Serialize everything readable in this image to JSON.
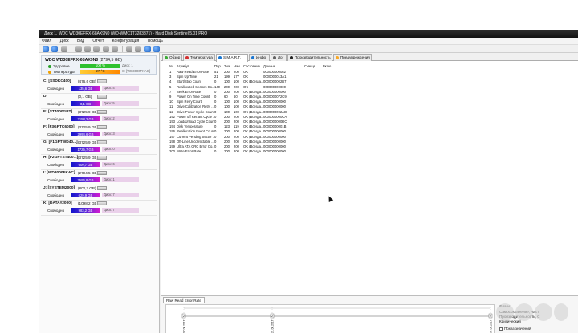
{
  "window": {
    "title": "Диск 1, WDC WD30EFRX-68AX9N0 (WD-WMC1T3283871) - Hard Disk Sentinel 5.01 PRO"
  },
  "menu": [
    "Файл",
    "Диск",
    "Вид",
    "Отчёт",
    "Конфигурация",
    "Помощь"
  ],
  "disk": {
    "name": "WDC WD30EFRX-68AX9N0",
    "size": "(2794,5 GB)",
    "health_label": "Здоровье",
    "health_value": "100 %",
    "health_side": "Диск: 1",
    "temp_label": "Температура",
    "temp_value": "27 °C",
    "temp_side": "S: [WD3000FKAC]"
  },
  "volumes": [
    {
      "name": "C: [SSDKC400]",
      "size": "(476,6 GB)",
      "free_label": "Свободно",
      "free": "135,6 GB",
      "disk": "Диск: 4"
    },
    {
      "name": "D:",
      "size": "(0,1 GB)",
      "free_label": "Свободно",
      "free": "0,1 GB",
      "disk": "Диск: 5"
    },
    {
      "name": "E: [ST4000GPT]",
      "size": "(3725,9 GB)",
      "free_label": "Свободно",
      "free": "2158,2 GB",
      "disk": "Диск: 2"
    },
    {
      "name": "F: [F3GPTC6000]",
      "size": "(3725,9 GB)",
      "free_label": "Свободно",
      "free": "2994,6 GB",
      "disk": "Диск: 3"
    },
    {
      "name": "G: [F1GPTWD40...]",
      "size": "(3725,9 GB)",
      "free_label": "Свободно",
      "free": "1725,7 GB",
      "disk": "Диск: 0"
    },
    {
      "name": "H: [F2GPTST400...]",
      "size": "(3725,9 GB)",
      "free_label": "Свободно",
      "free": "609,7 GB",
      "disk": "Диск: 6"
    },
    {
      "name": "I: [WD3000FKAC]",
      "size": "(2794,5 GB)",
      "free_label": "Свободно",
      "free": "2596,8 GB",
      "disk": "Диск: 1"
    },
    {
      "name": "J: [SYSTEM2000]",
      "size": "(802,7 GB)",
      "free_label": "Свободно",
      "free": "629,9 GB",
      "disk": "Диск: 7"
    },
    {
      "name": "K: [DATA#2000]",
      "size": "(1098,2 GB)",
      "free_label": "Свободно",
      "free": "983,2 GB",
      "disk": "Диск: 7"
    }
  ],
  "tabs": [
    {
      "label": "Обзор",
      "color": "#3aaa35"
    },
    {
      "label": "Температура",
      "color": "#d32f2f"
    },
    {
      "label": "S.M.A.R.T.",
      "color": "#1976d2"
    },
    {
      "label": "Инфо",
      "color": "#1976d2"
    },
    {
      "label": "Лог",
      "color": "#616161"
    },
    {
      "label": "Производительность",
      "color": "#212121"
    },
    {
      "label": "Предупреждения",
      "color": "#f9a825"
    }
  ],
  "smart": {
    "headers": [
      "№",
      "Атрибут",
      "Пор...",
      "Зна...",
      "Наи...",
      "Состояние",
      "Данные",
      "Смеще...",
      "Вклю..."
    ],
    "rows": [
      {
        "ok": true,
        "id": "1",
        "attr": "Raw Read Error Rate",
        "thr": "51",
        "val": "200",
        "worst": "200",
        "state": "OK",
        "data": "000000000082"
      },
      {
        "ok": true,
        "id": "3",
        "attr": "Spin Up Time",
        "thr": "21",
        "val": "199",
        "worst": "177",
        "state": "OK",
        "data": "0000000013A1"
      },
      {
        "ok": false,
        "id": "4",
        "attr": "Start/Stop Count",
        "thr": "0",
        "val": "100",
        "worst": "100",
        "state": "OK (Всегда...",
        "data": "0000000002B7"
      },
      {
        "ok": true,
        "id": "5",
        "attr": "Reallocated Sectors Co...",
        "thr": "140",
        "val": "200",
        "worst": "200",
        "state": "OK",
        "data": "000000000000"
      },
      {
        "ok": false,
        "id": "7",
        "attr": "Seek Error Rate",
        "thr": "0",
        "val": "200",
        "worst": "200",
        "state": "OK (Всегда...",
        "data": "000000000000"
      },
      {
        "ok": false,
        "id": "9",
        "attr": "Power On Time Count",
        "thr": "0",
        "val": "60",
        "worst": "60",
        "state": "OK (Всегда...",
        "data": "0000000072C9"
      },
      {
        "ok": true,
        "id": "10",
        "attr": "Spin Retry Count",
        "thr": "0",
        "val": "100",
        "worst": "100",
        "state": "OK (Всегда...",
        "data": "000000000000"
      },
      {
        "ok": false,
        "id": "11",
        "attr": "Drive Calibration Retry ...",
        "thr": "0",
        "val": "100",
        "worst": "100",
        "state": "OK (Всегда...",
        "data": "000000000000"
      },
      {
        "ok": false,
        "id": "12",
        "attr": "Drive Power Cycle Count",
        "thr": "0",
        "val": "100",
        "worst": "100",
        "state": "OK (Всегда...",
        "data": "0000000002AD"
      },
      {
        "ok": false,
        "id": "192",
        "attr": "Power off Retract Cycle ...",
        "thr": "0",
        "val": "200",
        "worst": "200",
        "state": "OK (Всегда...",
        "data": "0000000000CA"
      },
      {
        "ok": false,
        "id": "193",
        "attr": "Load/Unload Cycle Count",
        "thr": "0",
        "val": "200",
        "worst": "200",
        "state": "OK (Всегда...",
        "data": "0000000000DC"
      },
      {
        "ok": false,
        "id": "194",
        "attr": "Disk Temperature",
        "thr": "0",
        "val": "123",
        "worst": "119",
        "state": "OK (Всегда...",
        "data": "00000000001B"
      },
      {
        "ok": true,
        "id": "196",
        "attr": "Reallocation Event Count",
        "thr": "0",
        "val": "200",
        "worst": "200",
        "state": "OK (Всегда...",
        "data": "000000000000"
      },
      {
        "ok": true,
        "id": "197",
        "attr": "Current Pending Sector ...",
        "thr": "0",
        "val": "200",
        "worst": "200",
        "state": "OK (Всегда...",
        "data": "000000000000"
      },
      {
        "ok": true,
        "id": "198",
        "attr": "Off-Line Uncorrectable ...",
        "thr": "0",
        "val": "200",
        "worst": "200",
        "state": "OK (Всегда...",
        "data": "000000000000"
      },
      {
        "ok": false,
        "id": "199",
        "attr": "Ultra ATA CRC Error Co...",
        "thr": "0",
        "val": "200",
        "worst": "200",
        "state": "OK (Всегда...",
        "data": "000000000000"
      },
      {
        "ok": false,
        "id": "200",
        "attr": "Write Error Rate",
        "thr": "0",
        "val": "200",
        "worst": "200",
        "state": "OK (Всегда...",
        "data": "000000000000"
      }
    ]
  },
  "graph": {
    "tab_label": "Raw Read Error Rate",
    "points": [
      "2",
      "2",
      "2"
    ],
    "dates": [
      "07.08.2017",
      "21.08.2017",
      "07.09.2017"
    ],
    "side_title": "Флаги",
    "side_lines": [
      "Самосохранение, Част",
      "Производительность, С",
      "Критический"
    ],
    "show_values_label": "Показ значений"
  }
}
